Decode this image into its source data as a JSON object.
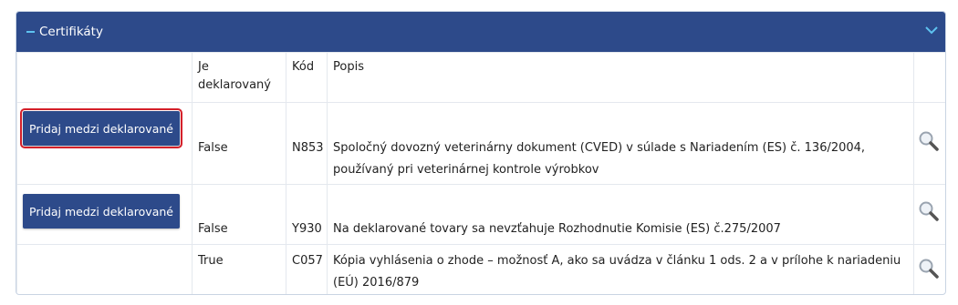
{
  "panel": {
    "title": "Certifikáty"
  },
  "table": {
    "headers": {
      "action": "",
      "declared": "Je deklarovaný",
      "code": "Kód",
      "description": "Popis",
      "view": ""
    },
    "rows": [
      {
        "button": "Pridaj medzi deklarované",
        "declared": "False",
        "code": "N853",
        "desc1": "Spoločný dovozný veterinárny dokument (CVED) v súlade s Nariadením (ES) č. 136/2004,",
        "desc2": "používaný pri veterinárnej kontrole výrobkov"
      },
      {
        "button": "Pridaj medzi deklarované",
        "declared": "False",
        "code": "Y930",
        "desc1": "Na deklarované tovary sa nevzťahuje Rozhodnutie Komisie (ES) č.275/2007"
      },
      {
        "declared": "True",
        "code": "C057",
        "desc1": "Kópia vyhlásenia o zhode – možnosť A, ako sa uvádza v článku 1 ods. 2 a v prílohe k nariadeniu",
        "desc2": "(EÚ) 2016/879"
      }
    ]
  },
  "colors": {
    "header_bg": "#2d4a8a",
    "accent": "#5ec3f0",
    "focus_outline": "#d4202a"
  }
}
